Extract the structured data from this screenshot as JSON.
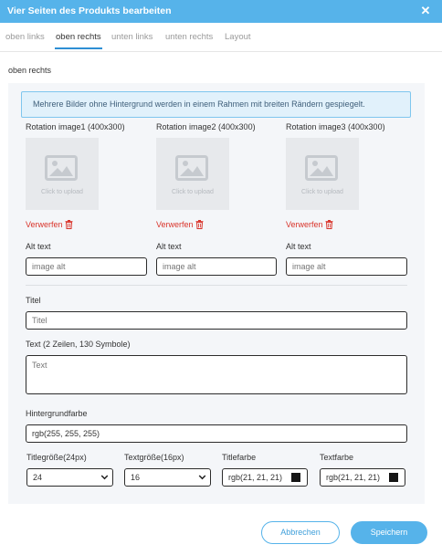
{
  "dialog": {
    "title": "Vier Seiten des Produkts bearbeiten"
  },
  "tabs": [
    {
      "label": "oben links",
      "active": false
    },
    {
      "label": "oben rechts",
      "active": true
    },
    {
      "label": "unten links",
      "active": false
    },
    {
      "label": "unten rechts",
      "active": false
    },
    {
      "label": "Layout",
      "active": false
    }
  ],
  "section": {
    "title": "oben rechts",
    "info": "Mehrere Bilder ohne Hintergrund werden in einem Rahmen mit breiten Rändern gespiegelt."
  },
  "images": [
    {
      "label": "Rotation image1 (400x300)",
      "upload_caption": "Click to upload",
      "discard": "Verwerfen",
      "alt_label": "Alt text",
      "alt_placeholder": "image alt"
    },
    {
      "label": "Rotation image2 (400x300)",
      "upload_caption": "Click to upload",
      "discard": "Verwerfen",
      "alt_label": "Alt text",
      "alt_placeholder": "image alt"
    },
    {
      "label": "Rotation image3 (400x300)",
      "upload_caption": "Click to upload",
      "discard": "Verwerfen",
      "alt_label": "Alt text",
      "alt_placeholder": "image alt"
    }
  ],
  "form": {
    "title_label": "Titel",
    "title_placeholder": "Titel",
    "text_label": "Text (2 Zeilen, 130 Symbole)",
    "text_placeholder": "Text",
    "bg_label": "Hintergrundfarbe",
    "bg_value": "rgb(255, 255, 255)",
    "bg_color": "#ffffff",
    "title_size_label": "Titlegröße(24px)",
    "title_size_value": "24",
    "text_size_label": "Textgröße(16px)",
    "text_size_value": "16",
    "title_color_label": "Titlefarbe",
    "title_color_value": "rgb(21, 21, 21)",
    "title_color": "#151515",
    "text_color_label": "Textfarbe",
    "text_color_value": "rgb(21, 21, 21)",
    "text_color": "#151515"
  },
  "buttons": {
    "cancel": "Abbrechen",
    "save": "Speichern"
  },
  "colors": {
    "accent": "#56b3ea",
    "danger": "#d9342b",
    "panel": "#f4f6f9",
    "info_bg": "#e1f1fb"
  }
}
